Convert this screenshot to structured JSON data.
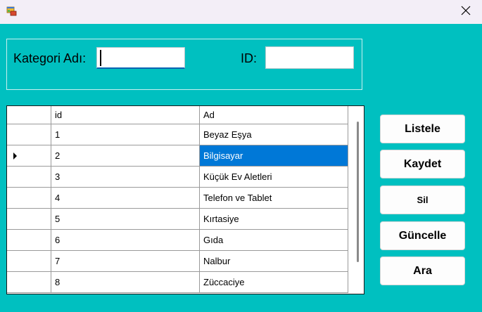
{
  "window": {
    "icon": "app-form-icon",
    "close_glyph": "✕"
  },
  "form": {
    "kategori_label": "Kategori Adı:",
    "kategori_value": "",
    "id_label": "ID:",
    "id_value": ""
  },
  "grid": {
    "columns": [
      "id",
      "Ad"
    ],
    "selected_row": 2,
    "rows": [
      {
        "id": "1",
        "ad": "Beyaz Eşya"
      },
      {
        "id": "2",
        "ad": "Bilgisayar"
      },
      {
        "id": "3",
        "ad": "Küçük Ev Aletleri"
      },
      {
        "id": "4",
        "ad": "Telefon ve Tablet"
      },
      {
        "id": "5",
        "ad": "Kırtasiye"
      },
      {
        "id": "6",
        "ad": "Gıda"
      },
      {
        "id": "7",
        "ad": "Nalbur"
      },
      {
        "id": "8",
        "ad": "Züccaciye"
      }
    ]
  },
  "buttons": {
    "listele": "Listele",
    "kaydet": "Kaydet",
    "sil": "Sil",
    "guncelle": "Güncelle",
    "ara": "Ara"
  }
}
